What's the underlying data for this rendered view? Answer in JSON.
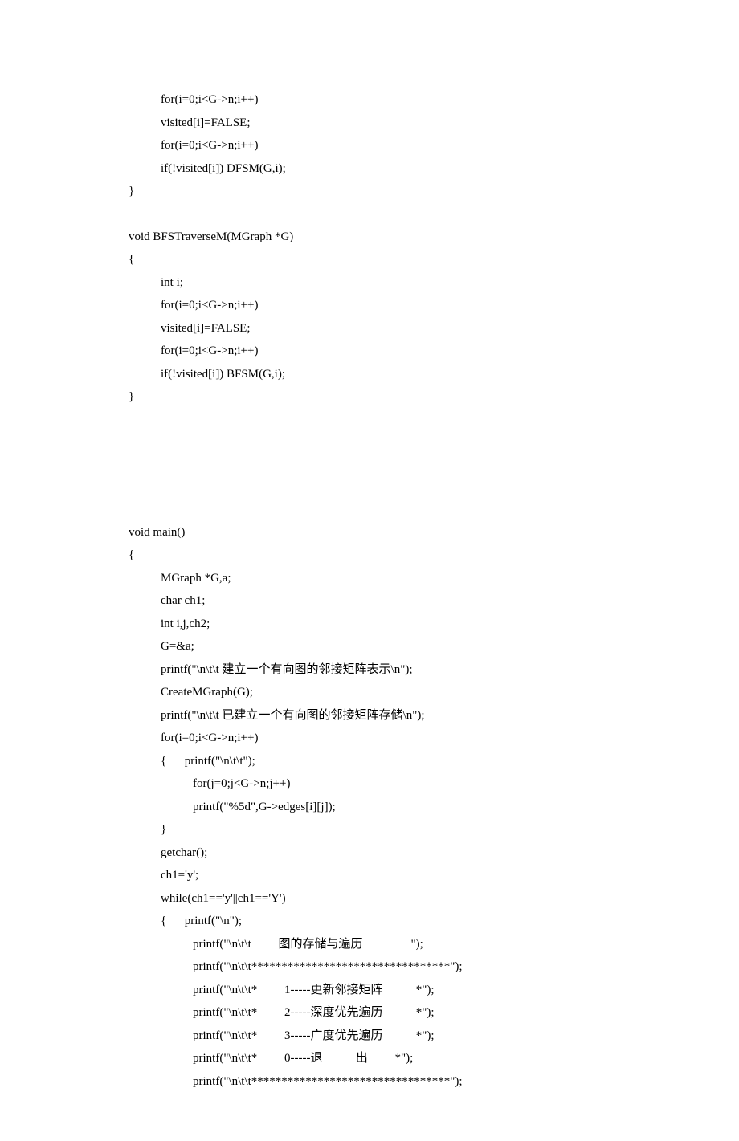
{
  "lines": {
    "l1": "for(i=0;i<G->n;i++)",
    "l2": "visited[i]=FALSE;",
    "l3": "for(i=0;i<G->n;i++)",
    "l4": "if(!visited[i]) DFSM(G,i);",
    "l5": "}",
    "l6": "void BFSTraverseM(MGraph *G)",
    "l7": "{",
    "l8": "int i;",
    "l9": "for(i=0;i<G->n;i++)",
    "l10": "visited[i]=FALSE;",
    "l11": "for(i=0;i<G->n;i++)",
    "l12": "if(!visited[i]) BFSM(G,i);",
    "l13": "}",
    "l14": "void main()",
    "l15": "{",
    "l16": "MGraph *G,a;",
    "l17": "char ch1;",
    "l18": "int i,j,ch2;",
    "l19": "G=&a;",
    "l20": "printf(\"\\n\\t\\t 建立一个有向图的邻接矩阵表示\\n\");",
    "l21": "CreateMGraph(G);",
    "l22": "printf(\"\\n\\t\\t 已建立一个有向图的邻接矩阵存储\\n\");",
    "l23": "for(i=0;i<G->n;i++)",
    "l24": "{      printf(\"\\n\\t\\t\");",
    "l25": "for(j=0;j<G->n;j++)",
    "l26": "printf(\"%5d\",G->edges[i][j]);",
    "l27": "}",
    "l28": "getchar();",
    "l29": "ch1='y';",
    "l30": "while(ch1=='y'||ch1=='Y')",
    "l31": "{      printf(\"\\n\");",
    "l32": "printf(\"\\n\\t\\t         图的存储与遍历                \");",
    "l33": "printf(\"\\n\\t\\t*********************************\");",
    "l34": "printf(\"\\n\\t\\t*         1-----更新邻接矩阵           *\");",
    "l35": "printf(\"\\n\\t\\t*         2-----深度优先遍历           *\");",
    "l36": "printf(\"\\n\\t\\t*         3-----广度优先遍历           *\");",
    "l37": "printf(\"\\n\\t\\t*         0-----退           出         *\");",
    "l38": "printf(\"\\n\\t\\t*********************************\");"
  }
}
